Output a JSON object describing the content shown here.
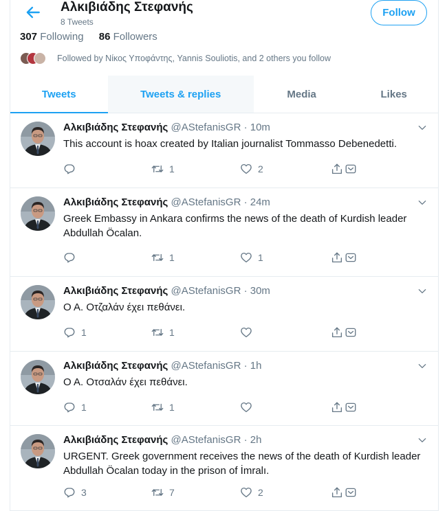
{
  "header": {
    "name": "Αλκιβιάδης Στεφανής",
    "tweet_count": "8 Tweets",
    "follow_label": "Follow"
  },
  "stats": {
    "following_count": "307",
    "following_label": "Following",
    "followers_count": "86",
    "followers_label": "Followers"
  },
  "followed_by": "Followed by Νίκος Υποφάντης, Yannis Souliotis, and 2 others you follow",
  "tabs": [
    {
      "label": "Tweets"
    },
    {
      "label": "Tweets & replies"
    },
    {
      "label": "Media"
    },
    {
      "label": "Likes"
    }
  ],
  "tweets": [
    {
      "author": "Αλκιβιάδης Στεφανής",
      "handle": "@AStefanisGR",
      "sep": "·",
      "time": "10m",
      "text": "This account is hoax created by Italian journalist Tommasso Debenedetti.",
      "replies": "",
      "retweets": "1",
      "likes": "2"
    },
    {
      "author": "Αλκιβιάδης Στεφανής",
      "handle": "@AStefanisGR",
      "sep": "·",
      "time": "24m",
      "text": "Greek Embassy in Ankara confirms the news of the death of Kurdish leader Abdullah Öcalan.",
      "replies": "",
      "retweets": "1",
      "likes": "1"
    },
    {
      "author": "Αλκιβιάδης Στεφανής",
      "handle": "@AStefanisGR",
      "sep": "·",
      "time": "30m",
      "text": "Ο Α. Οτζαλάν έχει πεθάνει.",
      "replies": "1",
      "retweets": "1",
      "likes": ""
    },
    {
      "author": "Αλκιβιάδης Στεφανής",
      "handle": "@AStefanisGR",
      "sep": "·",
      "time": "1h",
      "text": "Ο Α. Οτσαλάν έχει πεθάνει.",
      "replies": "1",
      "retweets": "1",
      "likes": ""
    },
    {
      "author": "Αλκιβιάδης Στεφανής",
      "handle": "@AStefanisGR",
      "sep": "·",
      "time": "2h",
      "text": "URGENT. Greek government receives the news of the death of Kurdish leader Abdullah Öcalan today in the prison of İmralı.",
      "replies": "3",
      "retweets": "7",
      "likes": "2"
    }
  ],
  "colors": {
    "accent": "#1da1f2",
    "secondary_text": "#657786",
    "divider": "#e6ecf0"
  },
  "icons": {
    "back": "arrow-left-icon",
    "reply": "speech-bubble-icon",
    "retweet": "retweet-arrows-icon",
    "like": "heart-icon",
    "share": "share-upload-icon",
    "menu": "chevron-down-icon"
  }
}
